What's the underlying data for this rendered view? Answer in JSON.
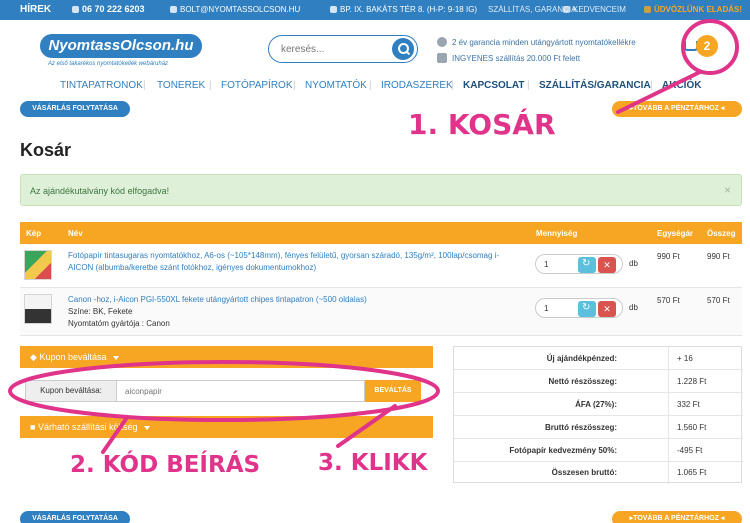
{
  "topbar": {
    "news": "HÍREK",
    "phone": "06 70 222 6203",
    "email": "BOLT@NYOMTASSOLCSON.HU",
    "address": "BP. IX. BAKÁTS TÉR 8. (H-P: 9-18 IG)",
    "shipping": "SZÁLLÍTÁS, GARANCIA",
    "favorites": "KEDVENCEIM",
    "welcome": "ÜDVÖZLÜNK ELADÁS!"
  },
  "header": {
    "logo": "NyomtassOlcson.hu",
    "logo_sub": "Az első takarékos nyomtatókellék webáruház",
    "search_placeholder": "keresés...",
    "promo1": "2 év garancia minden utángyártott nyomtatókellékre",
    "promo2": "INGYENES szállítás 20.000 Ft felett",
    "cart_count": "2"
  },
  "nav": [
    "TINTAPATRONOK",
    "TONEREK",
    "FOTÓPAPÍROK",
    "NYOMTATÓK",
    "IRODASZEREK",
    "KAPCSOLAT",
    "SZÁLLÍTÁS/GARANCIA",
    "AKCIÓK"
  ],
  "buttons": {
    "continue": "VÁSÁRLÁS FOLYTATÁSA",
    "checkout": "▸TOVÁBB A PÉNZTÁRHOZ ◂"
  },
  "page_title": "Kosár",
  "alert": "Az ajándékutalvány kód elfogadva!",
  "table": {
    "headers": [
      "Kép",
      "Név",
      "Mennyiség",
      "Egységár",
      "Összeg"
    ],
    "rows": [
      {
        "name": "Fotópapír tintasugaras nyomtatókhoz, A6-os (~105*148mm), fényes felületű, gyorsan száradó, 135g/m², 100lap/csomag i-AICON (albumba/keretbe szánt fotókhoz, igényes dokumentumokhoz)",
        "qty": "1",
        "unit": "db",
        "price": "990 Ft",
        "total": "990 Ft"
      },
      {
        "name": "Canon -hoz, i-Aicon PGI-550XL fekete utángyártott chipes tintapatron (~500 oldalas)",
        "color": "Színe: BK, Fekete",
        "maker": "Nyomtatóm gyártója : Canon",
        "qty": "1",
        "unit": "db",
        "price": "570 Ft",
        "total": "570 Ft"
      }
    ]
  },
  "coupon": {
    "header": "Kupon beváltása",
    "label": "Kupon beváltása:",
    "value": "aiconpapir",
    "apply": "BEVÁLTÁS",
    "shipping_header": "Várható szállítási költség"
  },
  "summary": [
    {
      "label": "Új ajándékpénzed:",
      "value": "+ 16"
    },
    {
      "label": "Nettó részösszeg:",
      "value": "1.228 Ft"
    },
    {
      "label": "ÁFA (27%):",
      "value": "332 Ft"
    },
    {
      "label": "Bruttó részösszeg:",
      "value": "1.560 Ft"
    },
    {
      "label": "Fotópapír kedvezmény 50%:",
      "value": "-495 Ft"
    },
    {
      "label": "Összesen bruttó:",
      "value": "1.065 Ft"
    }
  ],
  "annotations": {
    "step1": "1. KOSÁR",
    "step2": "2. KÓD BEÍRÁS",
    "step3": "3. KLIKK"
  },
  "colors": {
    "brand_blue": "#2f7fc1",
    "accent_orange": "#f6a623",
    "annotation_pink": "#e0338a",
    "alert_green": "#dff0d8"
  }
}
